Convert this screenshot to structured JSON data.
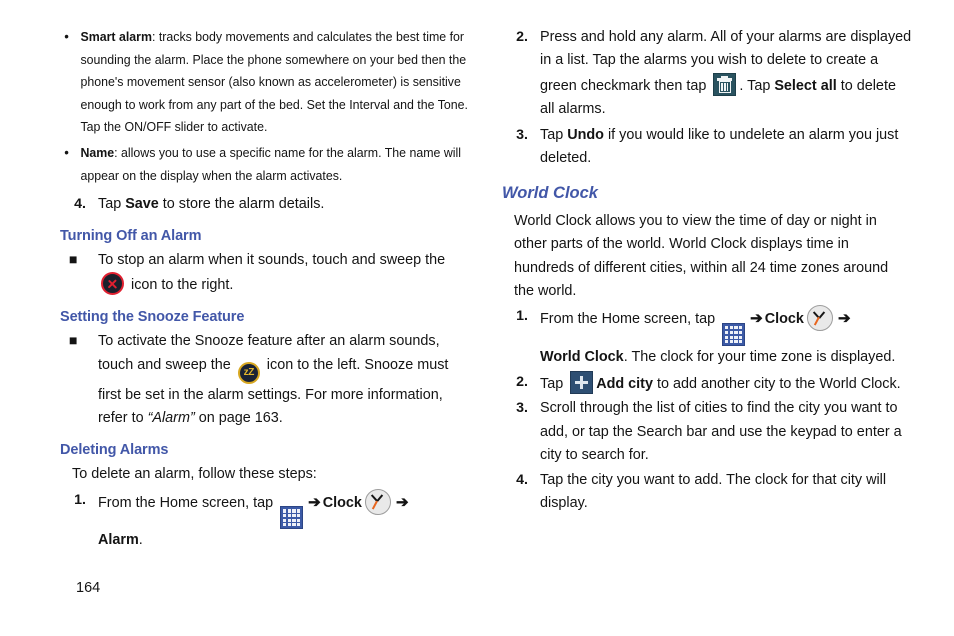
{
  "document": {
    "page_number": "164",
    "colors": {
      "heading_blue": "#4257a8",
      "body_text": "#141414",
      "apps_icon_blue": "#3c5aa6",
      "trash_icon_teal": "#2a5360",
      "plus_icon_blue": "#2e4f73",
      "dismiss_red": "#e02030",
      "snooze_gold": "#d8a822",
      "clock_second_hand": "#e8661f"
    }
  },
  "left_column": {
    "bullets": [
      {
        "term": "Smart alarm",
        "text": ": tracks body movements and calculates the best time for sounding the alarm. Place the phone somewhere on your bed then the phone's movement sensor (also known as accelerometer) is sensitive enough to work from any part of the bed. Set the Interval and the Tone. Tap the ON/OFF slider to activate."
      },
      {
        "term": "Name",
        "text": ": allows you to use a specific name for the alarm. The name will appear on the display when the alarm activates."
      }
    ],
    "step4": {
      "number": "4.",
      "pre": "Tap ",
      "bold": "Save",
      "post": " to store the alarm details."
    },
    "heading_turning_off": "Turning Off an Alarm",
    "turning_off_item": {
      "marker": "■",
      "pre": "To stop an alarm when it sounds, touch and sweep the ",
      "icon": "dismiss-alarm-icon",
      "post": " icon to the right."
    },
    "heading_snooze": "Setting the Snooze Feature",
    "snooze_item": {
      "marker": "■",
      "pre": "To activate the Snooze feature after an alarm sounds, touch and sweep the ",
      "icon": "snooze-icon",
      "mid": " icon to the left. Snooze must first be set in the alarm settings. For more information, refer to ",
      "ref_italic": "“Alarm”",
      "post": " on page 163."
    },
    "heading_deleting": "Deleting Alarms",
    "deleting_intro": "To delete an alarm, follow these steps:",
    "step1": {
      "number": "1.",
      "pre": "From the Home screen, tap ",
      "apps_icon": "apps-grid-icon",
      "arrow1": "➔",
      "clock_label": "Clock",
      "clock_icon": "clock-icon",
      "arrow2": "➔",
      "alarm_label": "Alarm",
      "period": "."
    }
  },
  "right_column": {
    "step2": {
      "number": "2.",
      "pre": "Press and hold any alarm. All of your alarms are displayed in a list. Tap the alarms you wish to delete to create a green checkmark then tap ",
      "trash_icon": "delete-trash-icon",
      "mid": ". Tap ",
      "bold": "Select all",
      "post": " to delete all alarms."
    },
    "step3": {
      "number": "3.",
      "pre": "Tap ",
      "bold": "Undo",
      "post": " if you would like to undelete an alarm you just deleted."
    },
    "heading_world_clock": "World Clock",
    "world_clock_intro": "World Clock allows you to view the time of day or night in other parts of the world. World Clock displays time in hundreds of different cities, within all 24 time zones around the world.",
    "wc_step1": {
      "number": "1.",
      "pre": "From the Home screen, tap ",
      "apps_icon": "apps-grid-icon",
      "arrow1": "➔",
      "clock_label": "Clock",
      "clock_icon": "clock-icon",
      "arrow2": "➔",
      "bold": "World Clock",
      "post": ". The clock for your time zone is displayed."
    },
    "wc_step2": {
      "number": "2.",
      "pre": "Tap ",
      "plus_icon": "add-city-plus-icon",
      "bold": "Add city",
      "post": " to add another city to the World Clock."
    },
    "wc_step3": {
      "number": "3.",
      "text": "Scroll through the list of cities to find the city you want to add, or tap the Search bar and use the keypad to enter a city to search for."
    },
    "wc_step4": {
      "number": "4.",
      "text": "Tap the city you want to add. The clock for that city will display."
    }
  }
}
